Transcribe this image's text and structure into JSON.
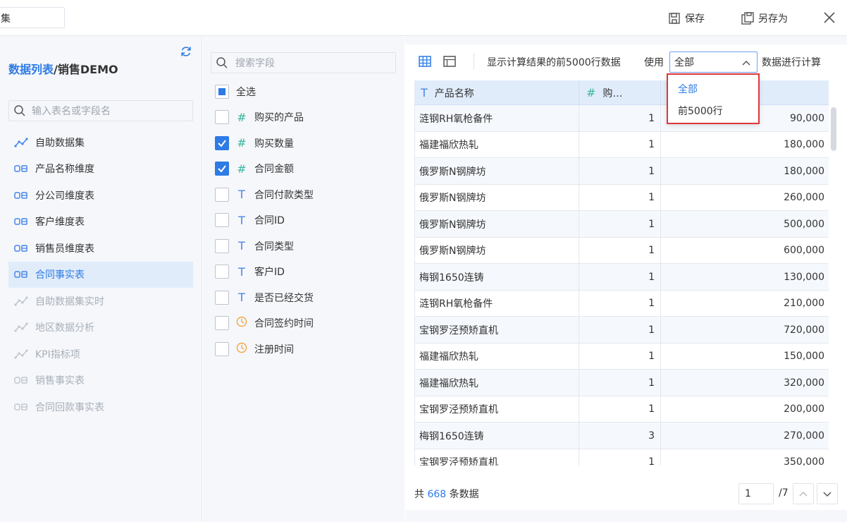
{
  "header": {
    "title_value": "集",
    "save_label": "保存",
    "save_as_label": "另存为"
  },
  "left": {
    "breadcrumb_link": "数据列表",
    "breadcrumb_sep": "/",
    "breadcrumb_current": "销售DEMO",
    "search_placeholder": "输入表名或字段名",
    "items": [
      {
        "label": "自助数据集",
        "icon": "self-dataset-icon",
        "state": "normal"
      },
      {
        "label": "产品名称维度",
        "icon": "db-table-icon",
        "state": "normal"
      },
      {
        "label": "分公司维度表",
        "icon": "db-table-icon",
        "state": "normal"
      },
      {
        "label": "客户维度表",
        "icon": "db-table-icon",
        "state": "normal"
      },
      {
        "label": "销售员维度表",
        "icon": "db-table-icon",
        "state": "normal"
      },
      {
        "label": "合同事实表",
        "icon": "db-table-icon",
        "state": "selected"
      },
      {
        "label": "自助数据集实时",
        "icon": "self-dataset-icon",
        "state": "disabled"
      },
      {
        "label": "地区数据分析",
        "icon": "self-dataset-icon",
        "state": "disabled"
      },
      {
        "label": "KPI指标项",
        "icon": "self-dataset-icon",
        "state": "disabled"
      },
      {
        "label": "销售事实表",
        "icon": "db-table-icon",
        "state": "disabled"
      },
      {
        "label": "合同回款事实表",
        "icon": "db-table-icon",
        "state": "disabled"
      }
    ]
  },
  "fields": {
    "search_placeholder": "搜索字段",
    "select_all_label": "全选",
    "items": [
      {
        "label": "购买的产品",
        "type": "#",
        "checked": false
      },
      {
        "label": "购买数量",
        "type": "#",
        "checked": true
      },
      {
        "label": "合同金额",
        "type": "#",
        "checked": true
      },
      {
        "label": "合同付款类型",
        "type": "T",
        "checked": false
      },
      {
        "label": "合同ID",
        "type": "T",
        "checked": false
      },
      {
        "label": "合同类型",
        "type": "T",
        "checked": false
      },
      {
        "label": "客户ID",
        "type": "T",
        "checked": false
      },
      {
        "label": "是否已经交货",
        "type": "T",
        "checked": false
      },
      {
        "label": "合同签约时间",
        "type": "time",
        "checked": false
      },
      {
        "label": "注册时间",
        "type": "time",
        "checked": false
      }
    ]
  },
  "preview": {
    "info_text": "显示计算结果的前5000行数据",
    "use_label": "使用",
    "select_value": "全部",
    "after_label": "数据进行计算",
    "dropdown_options": [
      "全部",
      "前5000行"
    ],
    "columns": [
      {
        "type": "T",
        "label": "产品名称"
      },
      {
        "type": "#",
        "label": "购…"
      },
      {
        "type": "#",
        "label": ""
      }
    ],
    "rows": [
      [
        "涟钢RH氧枪备件",
        "1",
        "90,000"
      ],
      [
        "福建福欣热轧",
        "1",
        "180,000"
      ],
      [
        "俄罗斯N钢牌坊",
        "1",
        "180,000"
      ],
      [
        "俄罗斯N钢牌坊",
        "1",
        "260,000"
      ],
      [
        "俄罗斯N钢牌坊",
        "1",
        "500,000"
      ],
      [
        "俄罗斯N钢牌坊",
        "1",
        "600,000"
      ],
      [
        "梅钢1650连铸",
        "1",
        "130,000"
      ],
      [
        "涟钢RH氧枪备件",
        "1",
        "210,000"
      ],
      [
        "宝钢罗泾预矫直机",
        "1",
        "720,000"
      ],
      [
        "福建福欣热轧",
        "1",
        "150,000"
      ],
      [
        "福建福欣热轧",
        "1",
        "320,000"
      ],
      [
        "宝钢罗泾预矫直机",
        "1",
        "200,000"
      ],
      [
        "梅钢1650连铸",
        "3",
        "270,000"
      ],
      [
        "宝钢罗泾预矫直机",
        "1",
        "350,000"
      ]
    ],
    "footer_prefix": "共",
    "total_rows": "668",
    "footer_suffix": "条数据",
    "page_value": "1",
    "page_total": "/7"
  },
  "colors": {
    "accent": "#2d7be5",
    "highlight_border": "#e0353a",
    "selected_bg": "#e1ecfb"
  }
}
